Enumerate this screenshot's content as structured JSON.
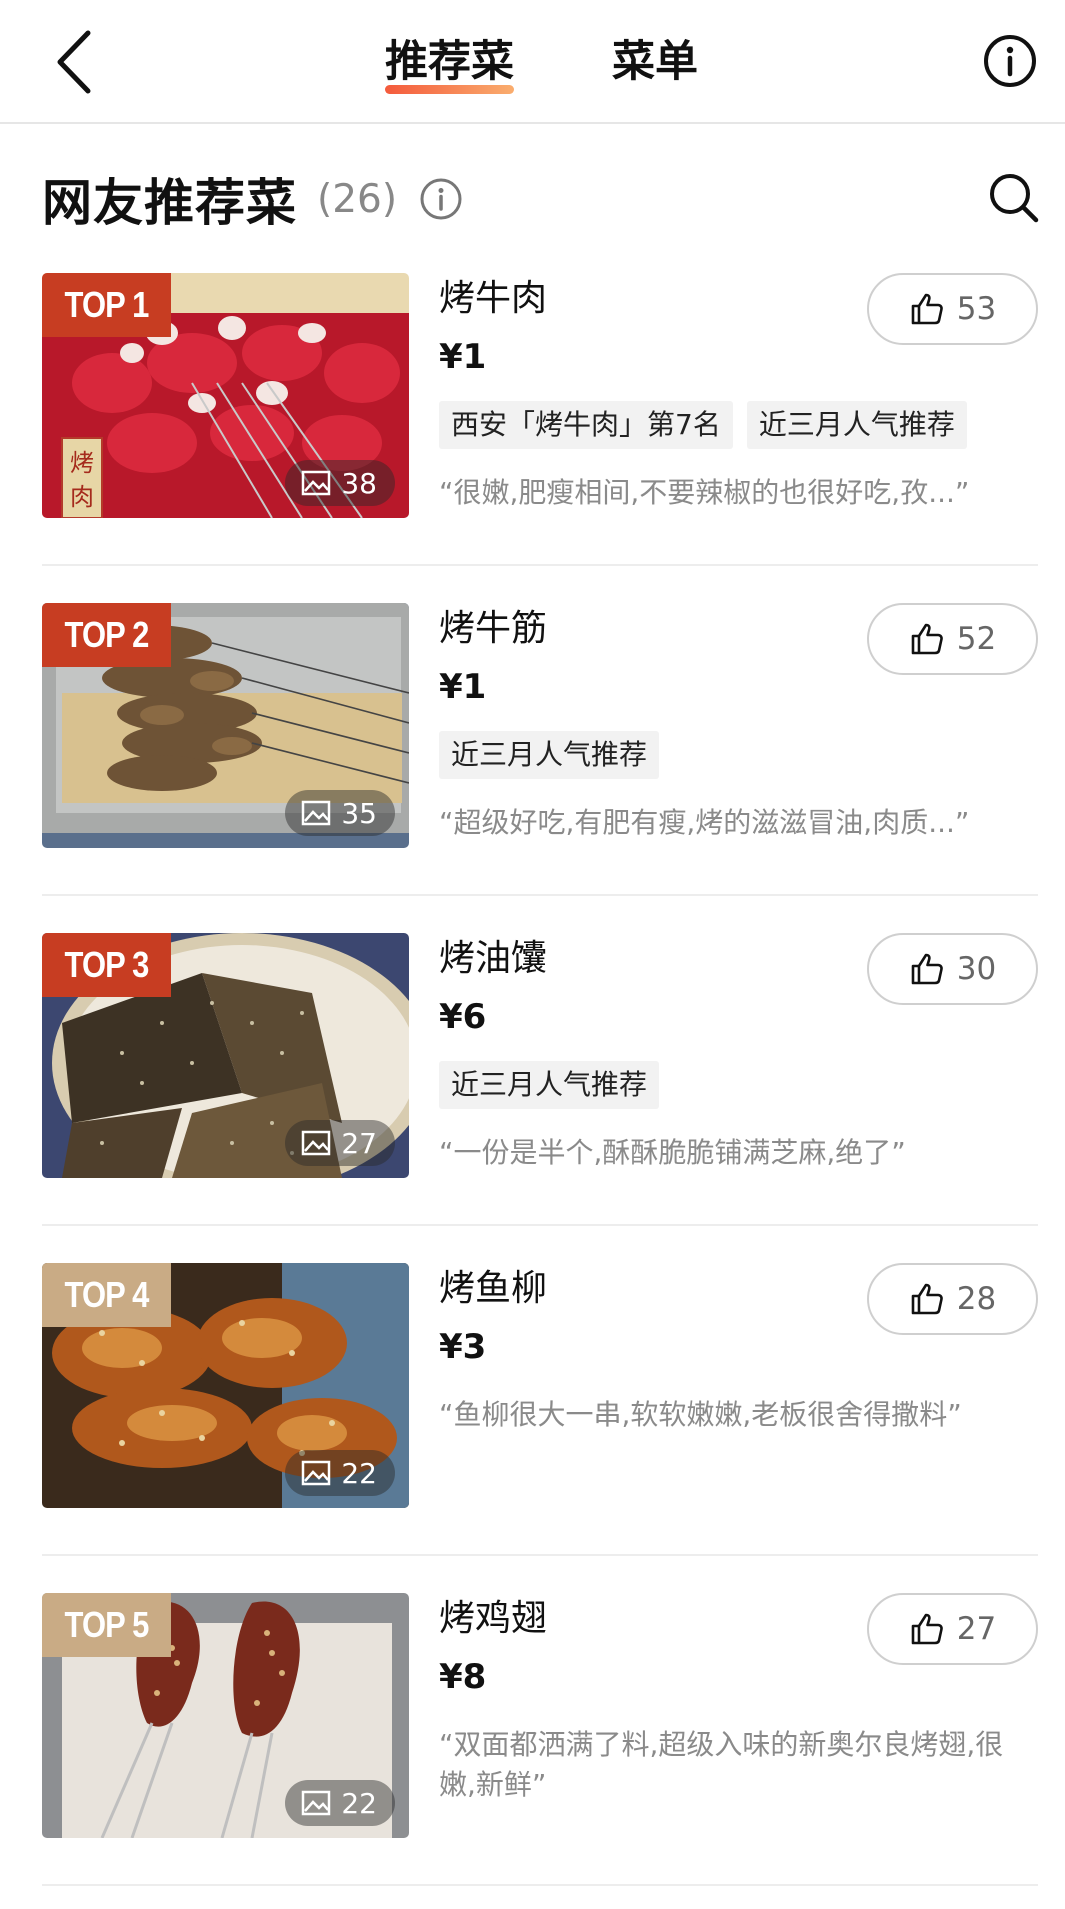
{
  "nav": {
    "tabs": [
      {
        "label": "推荐菜"
      },
      {
        "label": "菜单"
      }
    ]
  },
  "section": {
    "title": "网友推荐菜",
    "count": "(26)"
  },
  "colors": {
    "accent_red": "#c73d22",
    "badge_beige": "#c9ab85",
    "underline_gradient": [
      "#f34826",
      "#f9a45e"
    ]
  },
  "dishes": [
    {
      "rank": "TOP 1",
      "name": "烤牛肉",
      "price": "¥1",
      "likes": "53",
      "photos": "38",
      "tags": [
        "西安「烤牛肉」第7名",
        "近三月人气推荐"
      ],
      "quote": "“很嫩,肥瘦相间,不要辣椒的也很好吃,孜...”"
    },
    {
      "rank": "TOP 2",
      "name": "烤牛筋",
      "price": "¥1",
      "likes": "52",
      "photos": "35",
      "tags": [
        "近三月人气推荐"
      ],
      "quote": "“超级好吃,有肥有瘦,烤的滋滋冒油,肉质...”"
    },
    {
      "rank": "TOP 3",
      "name": "烤油馕",
      "price": "¥6",
      "likes": "30",
      "photos": "27",
      "tags": [
        "近三月人气推荐"
      ],
      "quote": "“一份是半个,酥酥脆脆铺满芝麻,绝了”"
    },
    {
      "rank": "TOP 4",
      "name": "烤鱼柳",
      "price": "¥3",
      "likes": "28",
      "photos": "22",
      "tags": [],
      "quote": "“鱼柳很大一串,软软嫩嫩,老板很舍得撒料”"
    },
    {
      "rank": "TOP 5",
      "name": "烤鸡翅",
      "price": "¥8",
      "likes": "27",
      "photos": "22",
      "tags": [],
      "quote": "“双面都洒满了料,超级入味的新奥尔良烤翅,很嫩,新鲜”"
    }
  ]
}
